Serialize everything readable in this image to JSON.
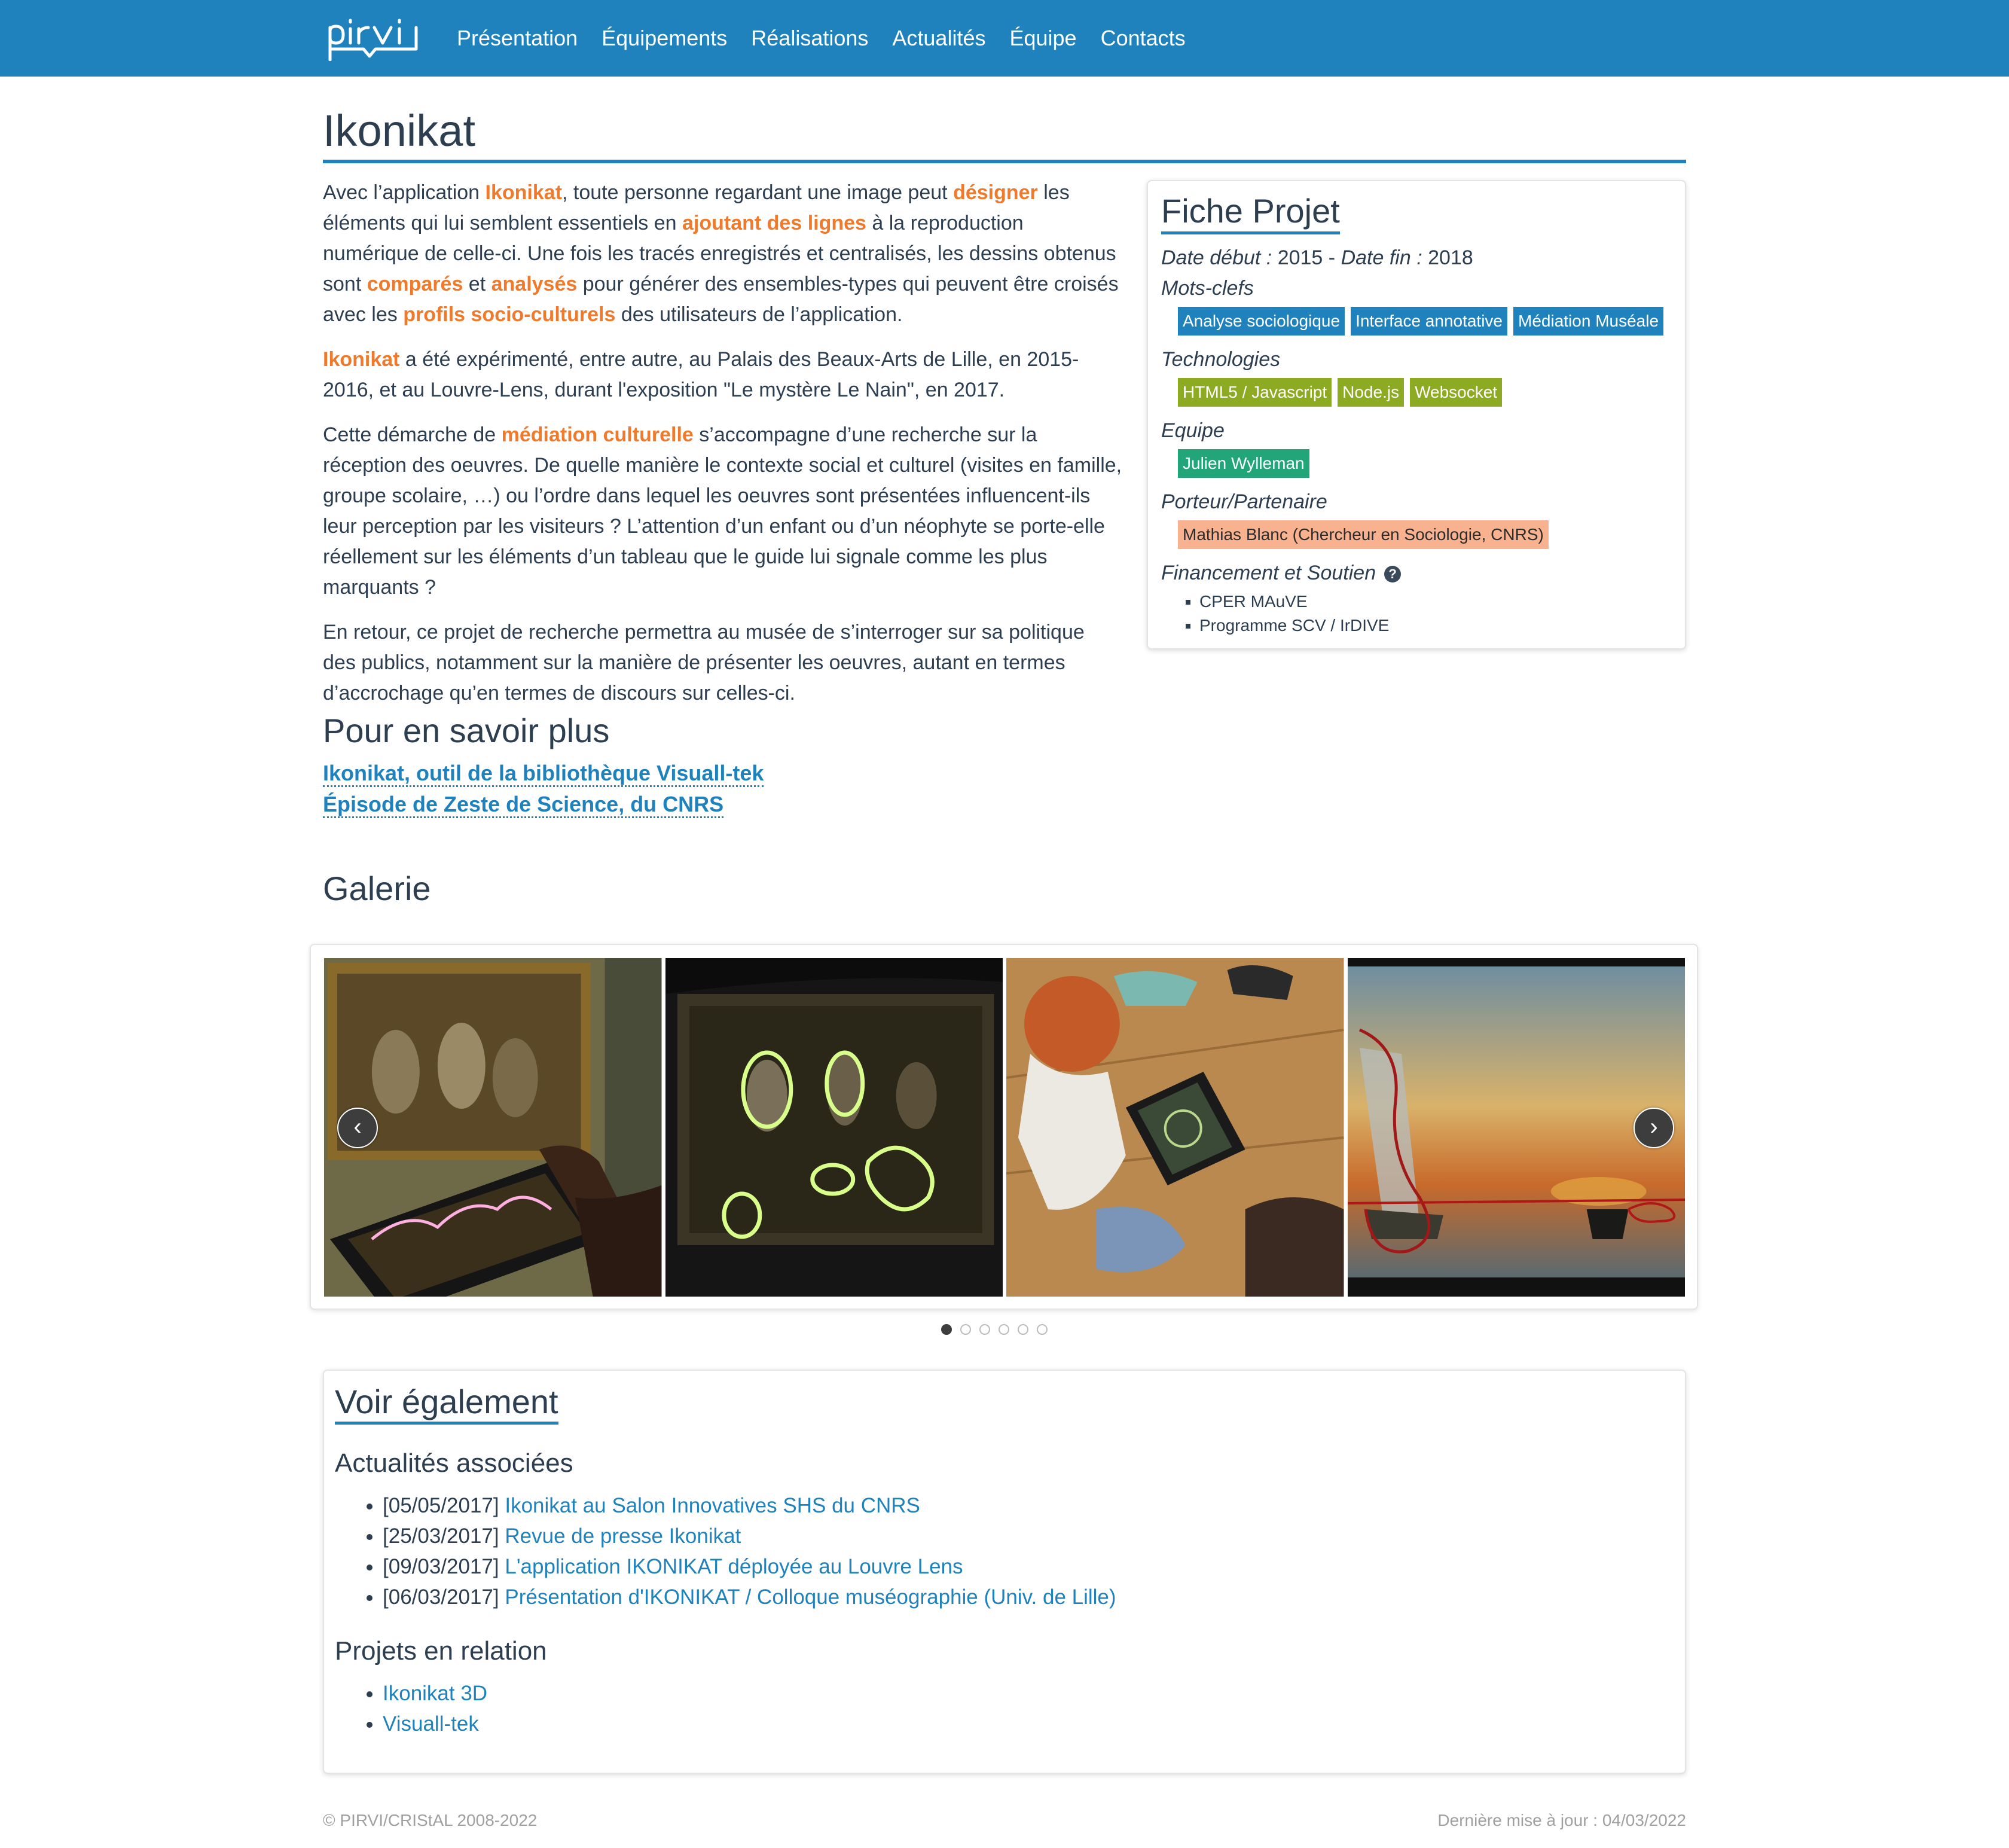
{
  "nav": {
    "logo": "pirvi",
    "items": [
      "Présentation",
      "Équipements",
      "Réalisations",
      "Actualités",
      "Équipe",
      "Contacts"
    ]
  },
  "page": {
    "title": "Ikonikat"
  },
  "content": {
    "p1": [
      {
        "t": "Avec l’application ",
        "hl": false
      },
      {
        "t": "Ikonikat",
        "hl": true
      },
      {
        "t": ", toute personne regardant une image peut ",
        "hl": false
      },
      {
        "t": "désigner",
        "hl": true
      },
      {
        "t": " les éléments qui lui semblent essentiels en ",
        "hl": false
      },
      {
        "t": "ajoutant des lignes",
        "hl": true
      },
      {
        "t": " à la reproduction numérique de celle-ci. Une fois les tracés enregistrés et centralisés, les dessins obtenus sont ",
        "hl": false
      },
      {
        "t": "comparés",
        "hl": true
      },
      {
        "t": " et ",
        "hl": false
      },
      {
        "t": "analysés",
        "hl": true
      },
      {
        "t": " pour générer des ensembles-types qui peuvent être croisés avec les ",
        "hl": false
      },
      {
        "t": "profils socio-culturels",
        "hl": true
      },
      {
        "t": " des utilisateurs de l’application.",
        "hl": false
      }
    ],
    "p2": [
      {
        "t": "Ikonikat",
        "hl": true
      },
      {
        "t": " a été expérimenté, entre autre, au Palais des Beaux-Arts de Lille, en 2015-2016, et au Louvre-Lens, durant l'exposition \"Le mystère Le Nain\", en 2017.",
        "hl": false
      }
    ],
    "p3": [
      {
        "t": "Cette démarche de ",
        "hl": false
      },
      {
        "t": "médiation culturelle",
        "hl": true
      },
      {
        "t": " s’accompagne d’une recherche sur la réception des oeuvres. De quelle manière le contexte social et culturel (visites en famille, groupe scolaire, …) ou l’ordre dans lequel les oeuvres sont présentées influencent-ils leur perception par les visiteurs ? L’attention d’un enfant ou d’un néophyte se porte-elle réellement sur les éléments d’un tableau que le guide lui signale comme les plus marquants ?",
        "hl": false
      }
    ],
    "p4": [
      {
        "t": "En retour, ce projet de recherche permettra au musée de s’interroger sur sa politique des publics, notamment sur la manière de présenter les oeuvres, autant en termes d’accrochage qu’en termes de discours sur celles-ci.",
        "hl": false
      }
    ]
  },
  "fiche": {
    "title": "Fiche Projet",
    "date_debut_label": "Date début :",
    "date_debut": "2015",
    "separator": "-",
    "date_fin_label": "Date fin :",
    "date_fin": "2018",
    "keywords_label": "Mots-clefs",
    "keywords": [
      "Analyse sociologique",
      "Interface annotative",
      "Médiation Muséale"
    ],
    "tech_label": "Technologies",
    "technologies": [
      "HTML5 / Javascript",
      "Node.js",
      "Websocket"
    ],
    "team_label": "Equipe",
    "team": [
      "Julien Wylleman"
    ],
    "partner_label": "Porteur/Partenaire",
    "partners": [
      "Mathias Blanc (Chercheur en Sociologie, CNRS)"
    ],
    "funding_label": "Financement et Soutien",
    "help_icon": "question-circle",
    "funding": [
      "CPER MAuVE",
      "Programme SCV / IrDIVE"
    ],
    "colors": {
      "keyword": "#1f82bd",
      "tech": "#8cab23",
      "team": "#23a57a",
      "partner": "#f9b28f"
    }
  },
  "more": {
    "title": "Pour en savoir plus",
    "links": [
      "Ikonikat, outil de la bibliothèque Visuall-tek",
      "Épisode de Zeste de Science, du CNRS"
    ]
  },
  "galerie": {
    "title": "Galerie",
    "prev": "‹",
    "next": "›",
    "slide_count": 6,
    "active_index": 0
  },
  "voir": {
    "title": "Voir également",
    "news_title": "Actualités associées",
    "news": [
      {
        "date": "[05/05/2017]",
        "label": "Ikonikat au Salon Innovatives SHS du CNRS"
      },
      {
        "date": "[25/03/2017]",
        "label": "Revue de presse Ikonikat"
      },
      {
        "date": "[09/03/2017]",
        "label": "L'application IKONIKAT déployée au Louvre Lens"
      },
      {
        "date": "[06/03/2017]",
        "label": "Présentation d'IKONIKAT / Colloque muséographie (Univ. de Lille)"
      }
    ],
    "projects_title": "Projets en relation",
    "projects": [
      "Ikonikat 3D",
      "Visuall-tek"
    ]
  },
  "footer": {
    "left": "© PIRVI/CRIStAL 2008-2022",
    "right": "Dernière mise à jour : 04/03/2022"
  },
  "colors": {
    "brand": "#1f82bd",
    "highlight": "#f07a2c",
    "text": "#2c3e50"
  }
}
